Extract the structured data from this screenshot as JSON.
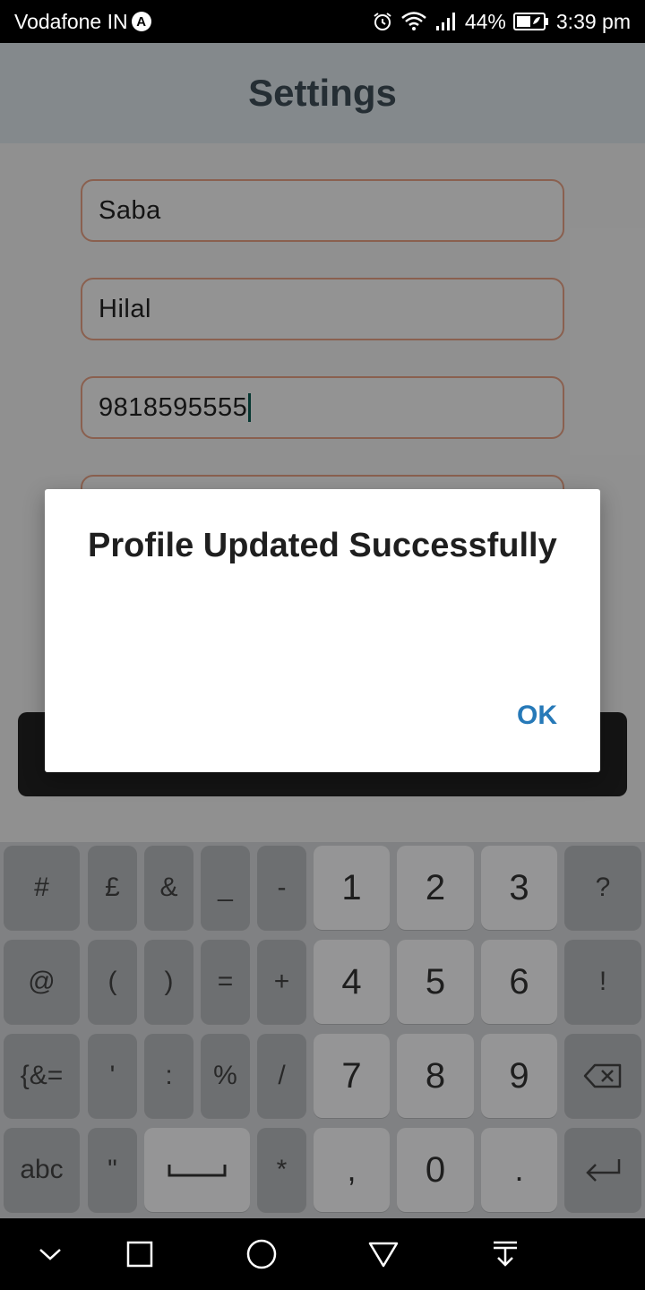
{
  "status_bar": {
    "carrier": "Vodafone IN",
    "carrier_badge": "A",
    "battery": "44%",
    "time": "3:39 pm",
    "icons": [
      "alarm-icon",
      "wifi-icon",
      "signal-icon",
      "battery-icon"
    ]
  },
  "app": {
    "title": "Settings",
    "fields": {
      "first_name": "Saba",
      "last_name": "Hilal",
      "phone": "9818595555"
    }
  },
  "dialog": {
    "title": "Profile Updated Successfully",
    "ok_label": "OK"
  },
  "keyboard": {
    "row1": [
      "#",
      "£",
      "&",
      "_",
      "-",
      "1",
      "2",
      "3",
      "?"
    ],
    "row2": [
      "@",
      "(",
      ")",
      "=",
      "+",
      "4",
      "5",
      "6",
      "!"
    ],
    "row3": [
      "{&=",
      "'",
      ":",
      "%",
      "/",
      "7",
      "8",
      "9"
    ],
    "row4": [
      "abc",
      "\"",
      "*",
      ",",
      "0",
      "."
    ],
    "icons": [
      "backspace-icon",
      "space-icon",
      "enter-icon"
    ]
  },
  "nav_bar": {
    "icons": [
      "chevron-down-icon",
      "square-icon",
      "circle-icon",
      "triangle-back-icon",
      "download-icon"
    ]
  },
  "colors": {
    "app_bar": "#dce5ea",
    "field_border": "#e7a184",
    "dialog_button": "#2679b8"
  }
}
